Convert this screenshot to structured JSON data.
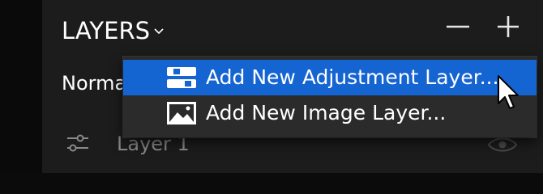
{
  "panel": {
    "title": "LAYERS",
    "title_chevron_icon": "chevron-down-icon",
    "remove_icon": "minus-icon",
    "add_icon": "plus-icon"
  },
  "blend_mode": {
    "value": "Normal"
  },
  "layers": [
    {
      "name": "Layer 1",
      "icon": "adjustment-sliders-icon",
      "visibility_icon": "eye-icon"
    }
  ],
  "add_menu": {
    "items": [
      {
        "label": "Add New Adjustment Layer...",
        "icon": "adjustment-layer-icon",
        "highlighted": true
      },
      {
        "label": "Add New Image Layer...",
        "icon": "image-icon",
        "highlighted": false
      }
    ]
  },
  "colors": {
    "panel_bg": "#1c1c1c",
    "highlight": "#1464d2",
    "menu_bg": "#2b2b2b",
    "dim_text": "#8a8a8a"
  }
}
